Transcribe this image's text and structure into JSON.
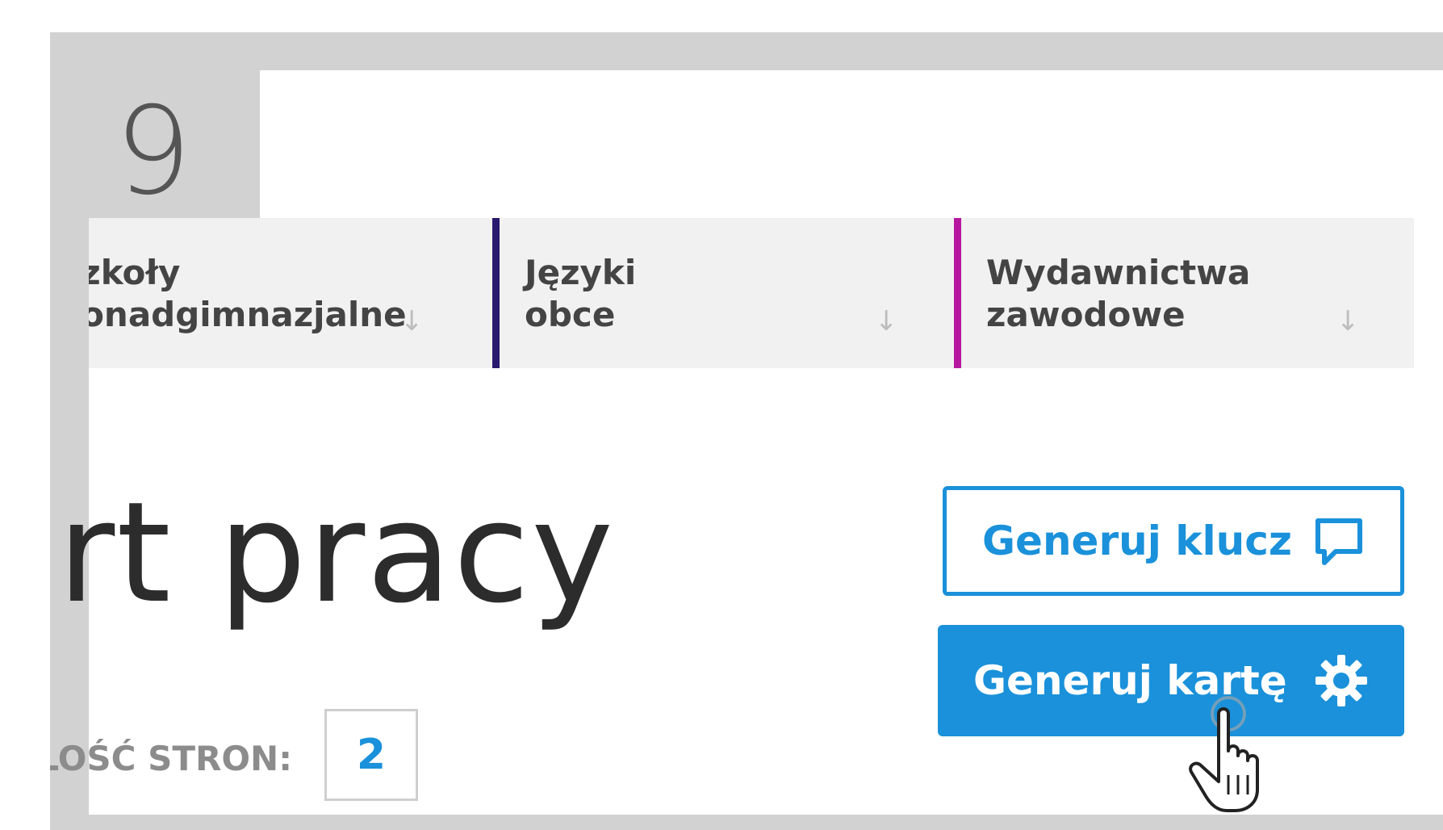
{
  "step": {
    "number": "9"
  },
  "categories": [
    {
      "label": "Szkoły\nponadgimnazjalne",
      "arrow": "↓",
      "color": ""
    },
    {
      "label": "Języki\nobce",
      "arrow": "↓",
      "color": "#2a1a6e"
    },
    {
      "label": "Wydawnictwa\nzawodowe",
      "arrow": "↓",
      "color": "#b5179e"
    }
  ],
  "main": {
    "title": "Raport pracy",
    "pages_label": "ILOŚĆ STRON:",
    "pages_value": "2"
  },
  "buttons": {
    "generate_key": {
      "label": "Generuj klucz",
      "icon": "speech-bubble-icon"
    },
    "generate_card": {
      "label": "Generuj kartę",
      "icon": "gear-icon"
    }
  },
  "colors": {
    "accent": "#1a91da",
    "frame": "#d2d2d2",
    "category_bg": "#f1f1f1"
  }
}
